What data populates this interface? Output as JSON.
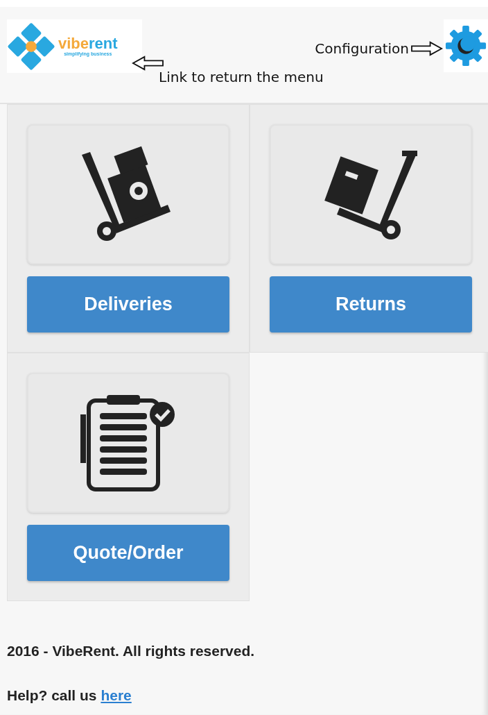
{
  "header": {
    "logo": {
      "wordmark": [
        "vibe",
        "rent"
      ],
      "tagline": "simplifying business"
    },
    "annotations": [
      {
        "kind": "config",
        "text": "Configuration"
      },
      {
        "kind": "home",
        "text": "Link to return the menu"
      }
    ]
  },
  "menu": [
    {
      "kind": "deliveries",
      "label": "Deliveries"
    },
    {
      "kind": "returns",
      "label": "Returns"
    },
    {
      "kind": "quote",
      "label": "Quote/Order"
    }
  ],
  "footer": {
    "copyright": "2016 - VibeRent. All rights reserved.",
    "help": "Help? call us",
    "link": "here"
  }
}
